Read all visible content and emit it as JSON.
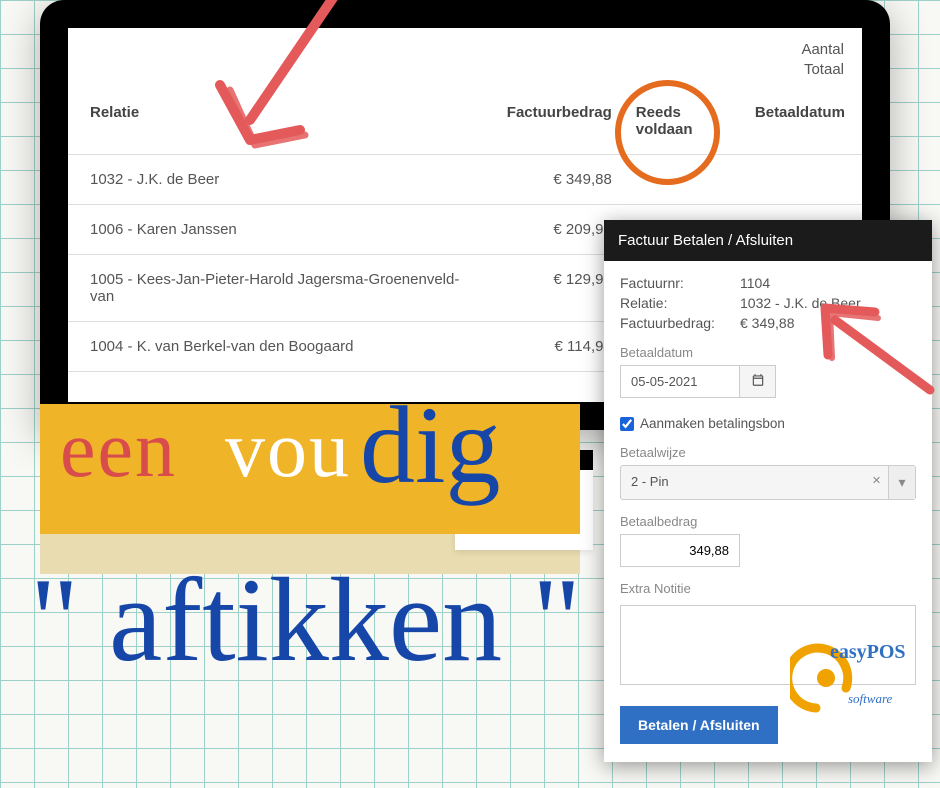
{
  "summary": {
    "line1": "Aantal",
    "line2": "Totaal"
  },
  "table": {
    "headers": {
      "relatie": "Relatie",
      "factuurbedrag": "Factuurbedrag",
      "reeds": "Reeds voldaan",
      "betaaldatum": "Betaaldatum"
    },
    "rows": [
      {
        "relatie": "1032 - J.K. de Beer",
        "bedrag": "€ 349,88"
      },
      {
        "relatie": "1006 - Karen Janssen",
        "bedrag": "€ 209,93"
      },
      {
        "relatie": "1005 - Kees-Jan-Pieter-Harold Jagersma-Groenenveld- van",
        "bedrag": "€ 129,99"
      },
      {
        "relatie": "1004 - K. van Berkel-van den Boogaard",
        "bedrag": "€ 114,94"
      }
    ]
  },
  "decor": {
    "een": "een",
    "vou": "vou",
    "dig": "dig",
    "aftikken": "\" aftikken \""
  },
  "popup": {
    "title": "Factuur Betalen / Afsluiten",
    "factuurnr_label": "Factuurnr:",
    "factuurnr_value": "1104",
    "relatie_label": "Relatie:",
    "relatie_value": "1032 - J.K. de Beer",
    "factuurbedrag_label": "Factuurbedrag:",
    "factuurbedrag_value": "€ 349,88",
    "betaaldatum_label": "Betaaldatum",
    "betaaldatum_value": "05-05-2021",
    "aanmaken_label": "Aanmaken betalingsbon",
    "betaalwijze_label": "Betaalwijze",
    "betaalwijze_value": "2 - Pin",
    "betaalbedrag_label": "Betaalbedrag",
    "betaalbedrag_value": "349,88",
    "notitie_label": "Extra Notitie",
    "submit_label": "Betalen / Afsluiten"
  },
  "logo": {
    "brand": "easyPOS",
    "sub": "software"
  }
}
